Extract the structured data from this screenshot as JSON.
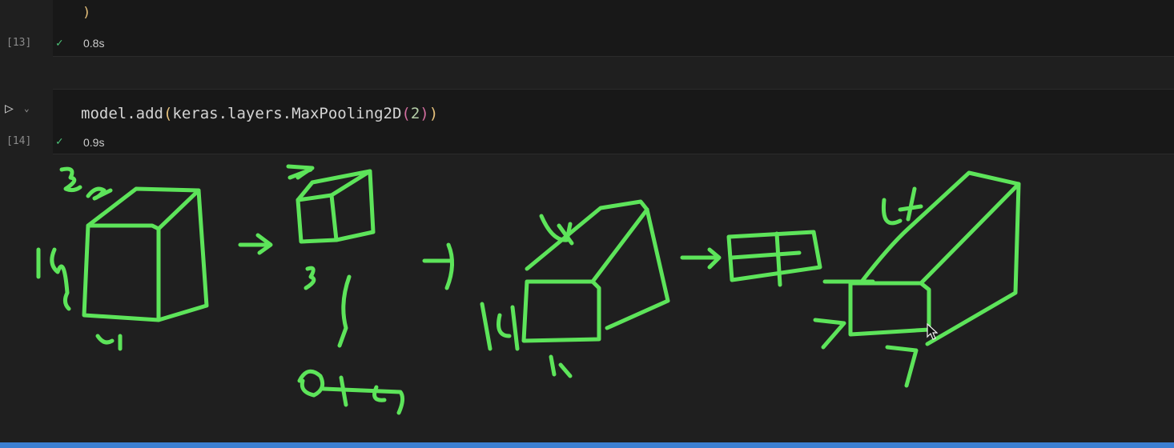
{
  "cells": [
    {
      "execution_count": "[13]",
      "code_tail": ")",
      "status": "success",
      "duration": "0.8s"
    },
    {
      "execution_count": "[14]",
      "code": {
        "obj": "model.add",
        "arg": "keras.layers.MaxPooling2D",
        "num": "2"
      },
      "status": "success",
      "duration": "0.9s"
    }
  ],
  "icons": {
    "run": "run-cell-icon",
    "check": "check-icon",
    "caret": "chevron-down-icon",
    "cursor": "mouse-cursor-icon"
  },
  "colors": {
    "ink": "#5de45a",
    "success": "#4ec97a",
    "status_bar": "#3c7fd1"
  }
}
